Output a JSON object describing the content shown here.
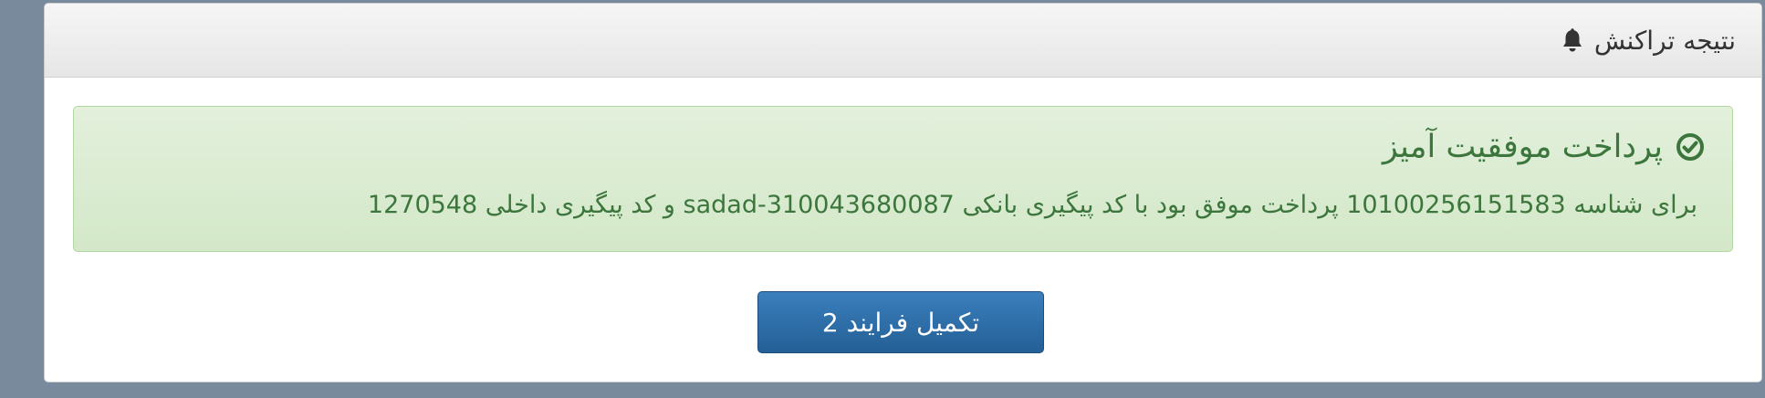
{
  "panel": {
    "title": "نتیجه تراکنش",
    "icon": "bell-icon"
  },
  "alert": {
    "heading": "پرداخت موفقیت آمیز",
    "icon": "check-circle-icon",
    "message": "برای شناسه 10100256151583 پرداخت موفق بود با کد پیگیری بانکی sadad-310043680087 و کد پیگیری داخلی 1270548",
    "text_color": "#3c763d",
    "background_color": "#dff0d8"
  },
  "actions": {
    "complete_label": "تکمیل فرایند 2",
    "button_color": "#2e6da4"
  }
}
